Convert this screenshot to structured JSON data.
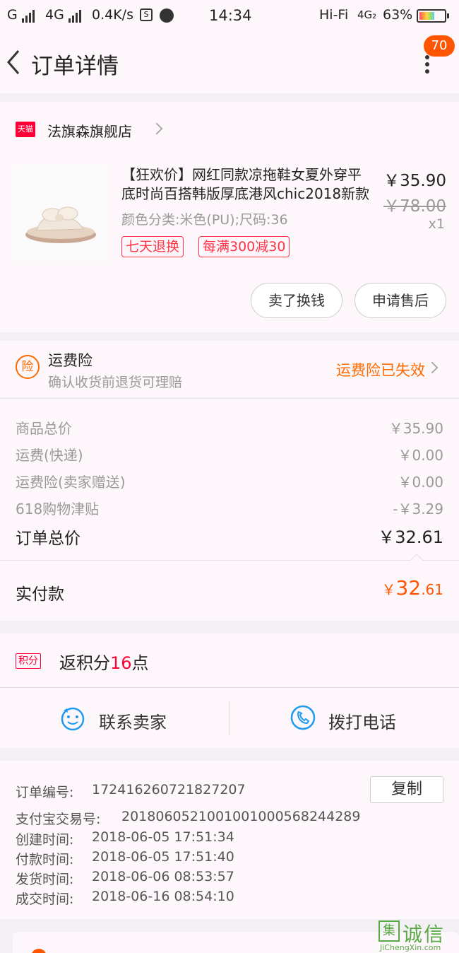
{
  "status_bar": {
    "carrier1": "G",
    "carrier2": "4G",
    "speed": "0.4K/s",
    "time": "14:34",
    "hifi": "Hi-Fi",
    "net": "4G₂",
    "battery": "63%",
    "battery_level": 0.63
  },
  "header": {
    "title": "订单详情",
    "badge_count": "70"
  },
  "shop": {
    "badge": "天猫",
    "name": "法旗森旗舰店"
  },
  "product": {
    "title": "【狂欢价】网红同款凉拖鞋女夏外穿平底时尚百搭韩版厚底港风chic2018新款",
    "sku": "颜色分类:米色(PU);尺码:36",
    "price": "￥35.90",
    "original_price": "￥78.00",
    "quantity": "x1",
    "tags": [
      "七天退换",
      "每满300减30"
    ],
    "actions": [
      "卖了换钱",
      "申请售后"
    ]
  },
  "insurance": {
    "icon_text": "险",
    "title": "运费险",
    "subtitle": "确认收货前退货可理赔",
    "status": "运费险已失效"
  },
  "breakdown": {
    "rows": [
      {
        "label": "商品总价",
        "value": "￥35.90"
      },
      {
        "label": "运费(快递)",
        "value": "￥0.00"
      },
      {
        "label": "运费险(卖家赠送)",
        "value": "￥0.00"
      },
      {
        "label": "618购物津贴",
        "value": "-￥3.29"
      }
    ],
    "total_label": "订单总价",
    "total_value": "￥32.61",
    "paid_label": "实付款",
    "paid_currency": "￥",
    "paid_int": "32",
    "paid_dec": ".61"
  },
  "points": {
    "tag": "积分",
    "prefix": "返积分",
    "value": "16",
    "suffix": "点"
  },
  "contact": {
    "seller_label": "联系卖家",
    "phone_label": "拨打电话"
  },
  "order_info": {
    "copy_label": "复制",
    "rows": [
      {
        "label": "订单编号:",
        "value": "172416260721827207"
      },
      {
        "label": "支付宝交易号:",
        "value": "2018060521001001000568244289"
      },
      {
        "label": "创建时间:",
        "value": "2018-06-05 17:51:34"
      },
      {
        "label": "付款时间:",
        "value": "2018-06-05 17:51:40"
      },
      {
        "label": "发货时间:",
        "value": "2018-06-06 08:53:57"
      },
      {
        "label": "成交时间:",
        "value": "2018-06-16 08:54:10"
      }
    ]
  },
  "watermark": {
    "mark": "集",
    "text": "诚信",
    "url": "JiChengXin.com"
  },
  "colors": {
    "accent": "#ff5500",
    "tmall_red": "#ff0036",
    "insurance_orange": "#ff6a00",
    "bg": "#fdf7fb"
  }
}
